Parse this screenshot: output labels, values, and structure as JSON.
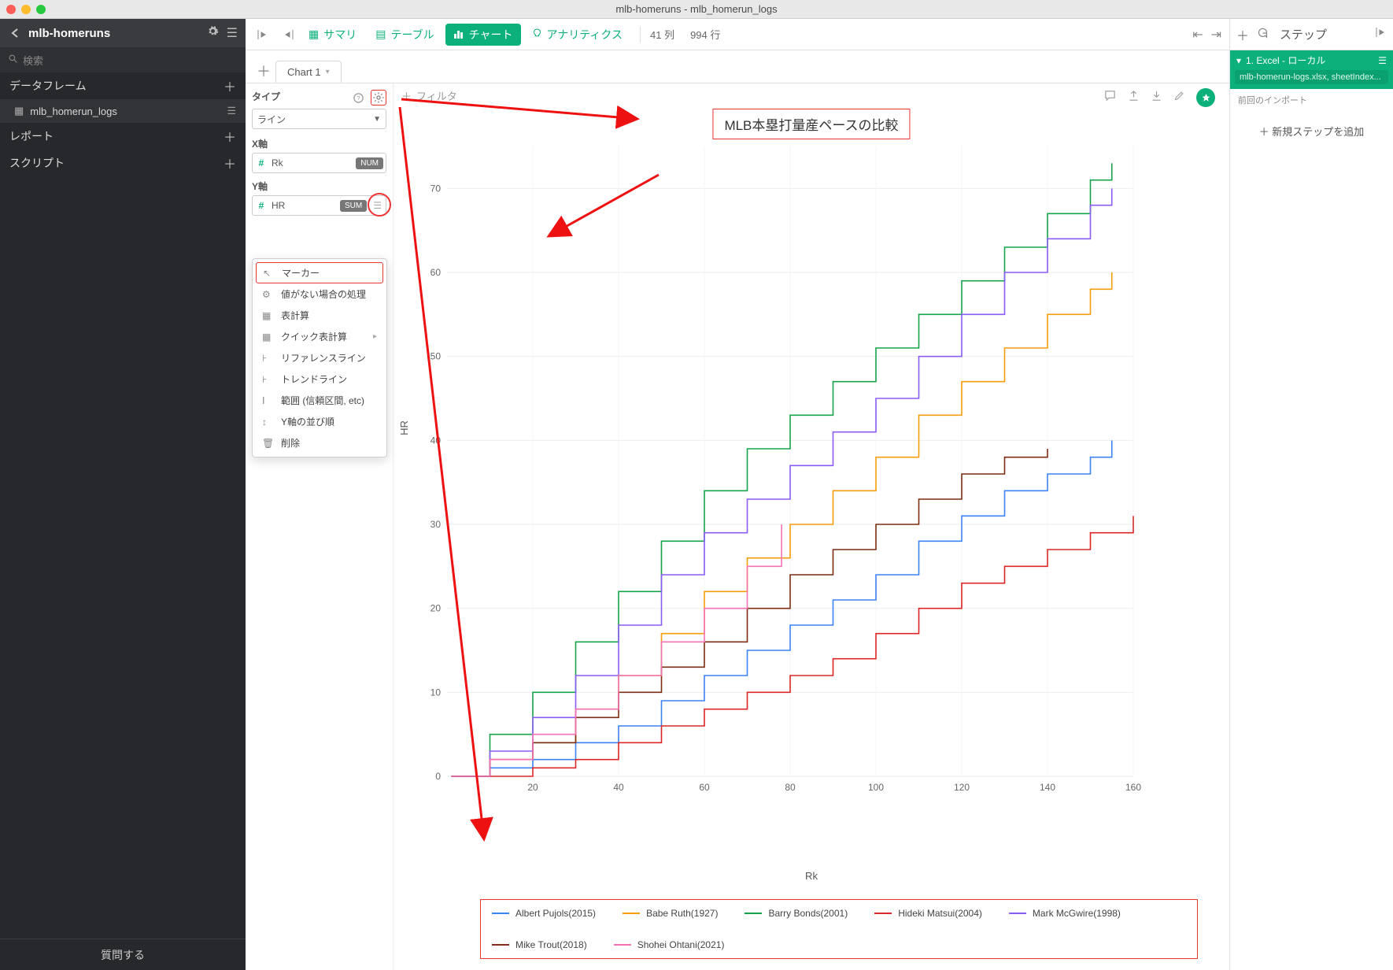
{
  "window": {
    "title": "mlb-homeruns - mlb_homerun_logs"
  },
  "sidebar": {
    "project": "mlb-homeruns",
    "search_placeholder": "検索",
    "sections": {
      "dataframe": "データフレーム",
      "report": "レポート",
      "script": "スクリプト"
    },
    "dataframe_items": [
      "mlb_homerun_logs"
    ],
    "footer": "質問する"
  },
  "toolbar": {
    "summary": "サマリ",
    "table": "テーブル",
    "chart": "チャート",
    "analytics": "アナリティクス",
    "cols_label": "41 列",
    "rows_label": "994 行"
  },
  "chart_tabs": {
    "tab1": "Chart 1"
  },
  "config": {
    "type_label": "タイプ",
    "type_value": "ライン",
    "x_label": "X軸",
    "x_field": "Rk",
    "x_badge": "NUM",
    "y_label": "Y軸",
    "y_field": "HR",
    "y_badge": "SUM",
    "menu": {
      "marker": "マーカー",
      "missing": "値がない場合の処理",
      "tablecalc": "表計算",
      "quickcalc": "クイック表計算",
      "refline": "リファレンスライン",
      "trend": "トレンドライン",
      "range": "範囲 (信頼区間, etc)",
      "sort": "Y軸の並び順",
      "delete": "削除"
    }
  },
  "chart": {
    "filter_label": "フィルタ",
    "title": "MLB本塁打量産ペースの比較",
    "xlabel": "Rk",
    "ylabel": "HR"
  },
  "steps": {
    "header": "ステップ",
    "step1_title": "1. Excel - ローカル",
    "step1_file": "mlb-homerun-logs.xlsx, sheetIndex...",
    "step1_note": "前回のインポート",
    "add": "新規ステップを追加"
  },
  "legend": {
    "s0": "Albert Pujols(2015)",
    "s1": "Babe Ruth(1927)",
    "s2": "Barry Bonds(2001)",
    "s3": "Hideki Matsui(2004)",
    "s4": "Mark McGwire(1998)",
    "s5": "Mike Trout(2018)",
    "s6": "Shohei Ohtani(2021)"
  },
  "chart_data": {
    "type": "line",
    "xlabel": "Rk",
    "ylabel": "HR",
    "xlim": [
      0,
      160
    ],
    "ylim": [
      0,
      75
    ],
    "x_ticks": [
      20,
      40,
      60,
      80,
      100,
      120,
      140,
      160
    ],
    "y_ticks": [
      0,
      10,
      20,
      30,
      40,
      50,
      60,
      70
    ],
    "series": [
      {
        "name": "Albert Pujols(2015)",
        "color": "#3b82f6",
        "x": [
          1,
          10,
          20,
          30,
          40,
          50,
          60,
          70,
          80,
          90,
          100,
          110,
          120,
          130,
          140,
          150,
          155
        ],
        "y": [
          0,
          1,
          2,
          4,
          6,
          9,
          12,
          15,
          18,
          21,
          24,
          28,
          31,
          34,
          36,
          38,
          40
        ]
      },
      {
        "name": "Babe Ruth(1927)",
        "color": "#f59e0b",
        "x": [
          1,
          10,
          20,
          30,
          40,
          50,
          60,
          70,
          80,
          90,
          100,
          110,
          120,
          130,
          140,
          150,
          155
        ],
        "y": [
          0,
          2,
          4,
          8,
          12,
          17,
          22,
          26,
          30,
          34,
          38,
          43,
          47,
          51,
          55,
          58,
          60
        ]
      },
      {
        "name": "Barry Bonds(2001)",
        "color": "#16a34a",
        "x": [
          1,
          10,
          20,
          30,
          40,
          50,
          60,
          70,
          80,
          90,
          100,
          110,
          120,
          130,
          140,
          150,
          155
        ],
        "y": [
          0,
          5,
          10,
          16,
          22,
          28,
          34,
          39,
          43,
          47,
          51,
          55,
          59,
          63,
          67,
          71,
          73
        ]
      },
      {
        "name": "Hideki Matsui(2004)",
        "color": "#dc2626",
        "x": [
          1,
          10,
          20,
          30,
          40,
          50,
          60,
          70,
          80,
          90,
          100,
          110,
          120,
          130,
          140,
          150,
          160
        ],
        "y": [
          0,
          0,
          1,
          2,
          4,
          6,
          8,
          10,
          12,
          14,
          17,
          20,
          23,
          25,
          27,
          29,
          31
        ]
      },
      {
        "name": "Mark McGwire(1998)",
        "color": "#8b5cf6",
        "x": [
          1,
          10,
          20,
          30,
          40,
          50,
          60,
          70,
          80,
          90,
          100,
          110,
          120,
          130,
          140,
          150,
          155
        ],
        "y": [
          0,
          3,
          7,
          12,
          18,
          24,
          29,
          33,
          37,
          41,
          45,
          50,
          55,
          60,
          64,
          68,
          70
        ]
      },
      {
        "name": "Mike Trout(2018)",
        "color": "#7c2d12",
        "x": [
          1,
          10,
          20,
          30,
          40,
          50,
          60,
          70,
          80,
          90,
          100,
          110,
          120,
          130,
          140
        ],
        "y": [
          0,
          2,
          4,
          7,
          10,
          13,
          16,
          20,
          24,
          27,
          30,
          33,
          36,
          38,
          39
        ]
      },
      {
        "name": "Shohei Ohtani(2021)",
        "color": "#f472b6",
        "x": [
          1,
          10,
          20,
          30,
          40,
          50,
          60,
          70,
          78
        ],
        "y": [
          0,
          2,
          5,
          8,
          12,
          16,
          20,
          25,
          30
        ]
      }
    ]
  }
}
